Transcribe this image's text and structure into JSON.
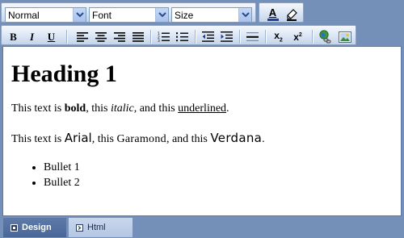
{
  "toolbar": {
    "format_select": "Normal",
    "font_select": "Font",
    "size_select": "Size",
    "buttons": {
      "bold": "B",
      "italic": "I",
      "underline": "U",
      "font_color": "A",
      "subscript": "x",
      "subscript_mark": "2",
      "superscript": "x",
      "superscript_mark": "2"
    }
  },
  "content": {
    "heading": "Heading 1",
    "p1": {
      "t1": "This text is ",
      "bold": "bold",
      "t2": ", this ",
      "italic": "italic",
      "t3": ", and this ",
      "underlined": "underlined",
      "t4": "."
    },
    "p2": {
      "t1": "This text is ",
      "arial": "Arial",
      "t2": ", this ",
      "garamond": "Garamond",
      "t3": ", and this ",
      "verdana": "Verdana",
      "t4": "."
    },
    "bullets": [
      "Bullet 1",
      "Bullet 2"
    ]
  },
  "tabs": {
    "design": "Design",
    "html": "Html"
  },
  "colors": {
    "frame": "#7590b8",
    "active_tab": "#4a6799",
    "inactive_tab": "#b3c6e3",
    "font_color_bar": "#1e3f9a"
  }
}
